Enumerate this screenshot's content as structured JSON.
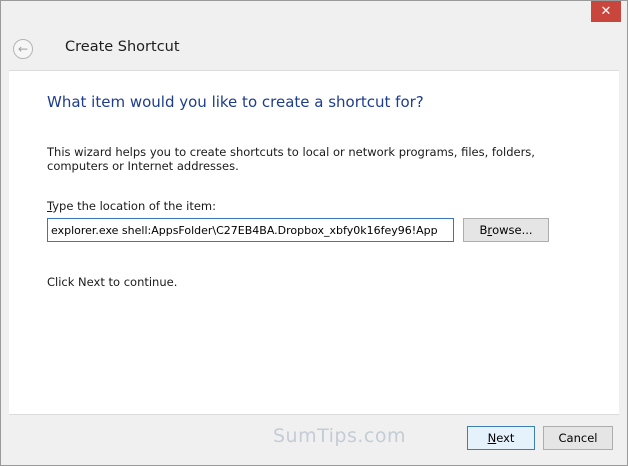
{
  "window": {
    "title": "Create Shortcut",
    "close_glyph": "✕",
    "back_glyph": "←"
  },
  "content": {
    "heading": "What item would you like to create a shortcut for?",
    "description": "This wizard helps you to create shortcuts to local or network programs, files, folders, computers or Internet addresses.",
    "location_label_accel": "T",
    "location_label_rest": "ype the location of the item:",
    "location_value": "explorer.exe shell:AppsFolder\\C27EB4BA.Dropbox_xbfy0k16fey96!App",
    "browse_accel": "r",
    "browse_pre": "B",
    "browse_post": "owse...",
    "continue_text": "Click Next to continue."
  },
  "footer": {
    "watermark": "SumTips.com",
    "next_accel": "N",
    "next_rest": "ext",
    "cancel_label": "Cancel"
  },
  "colors": {
    "heading": "#1e3d8f",
    "close_button": "#c9463d",
    "input_border": "#3a75c4"
  }
}
